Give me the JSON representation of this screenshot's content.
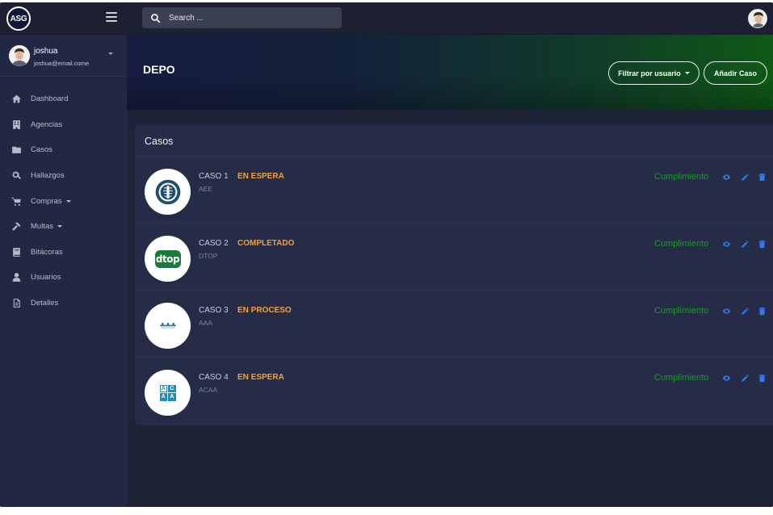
{
  "app": {
    "logo_text": "ASG"
  },
  "search": {
    "placeholder": "Search ..."
  },
  "user": {
    "name": "joshua",
    "email": "joshua@email.come"
  },
  "sidebar": {
    "items": [
      {
        "label": "Dashboard",
        "icon": "home-icon"
      },
      {
        "label": "Agencias",
        "icon": "building-icon"
      },
      {
        "label": "Casos",
        "icon": "folder-icon"
      },
      {
        "label": "Hallazgos",
        "icon": "search-icon"
      },
      {
        "label": "Compras",
        "icon": "cart-icon",
        "dropdown": true
      },
      {
        "label": "Multas",
        "icon": "gavel-icon",
        "dropdown": true
      },
      {
        "label": "Bitácoras",
        "icon": "book-icon"
      },
      {
        "label": "Usuarios",
        "icon": "user-icon"
      },
      {
        "label": "Detalles",
        "icon": "document-icon"
      }
    ]
  },
  "header": {
    "title": "DEPO",
    "filter_label": "Filtrar por usuario",
    "add_label": "Añadir Caso"
  },
  "cases_card": {
    "title": "Casos",
    "cases": [
      {
        "name": "CASO 1",
        "status": "EN ESPERA",
        "agency": "AEE",
        "compliance": "Cumplimiento",
        "logo": "aee-logo"
      },
      {
        "name": "CASO 2",
        "status": "COMPLETADO",
        "agency": "DTOP",
        "compliance": "Cumplimiento",
        "logo": "dtop-logo",
        "logo_text": "dtop"
      },
      {
        "name": "CASO 3",
        "status": "EN PROCESO",
        "agency": "AAA",
        "compliance": "Cumplimiento",
        "logo": "aaa-logo"
      },
      {
        "name": "CASO 4",
        "status": "EN ESPERA",
        "agency": "ACAA",
        "compliance": "Cumplimiento",
        "logo": "acaa-logo",
        "logo_letters": [
          "A",
          "C",
          "A",
          "A"
        ]
      }
    ]
  },
  "colors": {
    "status": "#f5a030",
    "compliance": "#1a9a2a",
    "action": "#2d7cf6",
    "sidebar_bg": "#222843",
    "card_bg": "#262c47"
  }
}
